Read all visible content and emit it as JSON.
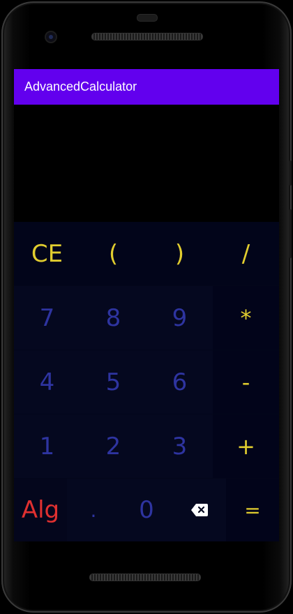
{
  "app": {
    "title": "AdvancedCalculator"
  },
  "display": {
    "expression": "",
    "result": ""
  },
  "keypad": {
    "row1": [
      "CE",
      "(",
      ")",
      "/"
    ],
    "row2": [
      "7",
      "8",
      "9",
      "*"
    ],
    "row3": [
      "4",
      "5",
      "6",
      "-"
    ],
    "row4": [
      "1",
      "2",
      "3",
      "+"
    ],
    "row5": [
      "Alg",
      ".",
      "0",
      "backspace-icon",
      "="
    ]
  },
  "colors": {
    "appbar": "#6200ee",
    "digit": "#2e34a0",
    "operator": "#e1cd2f",
    "alg": "#e03030",
    "keypad_bg": "#03061a"
  }
}
